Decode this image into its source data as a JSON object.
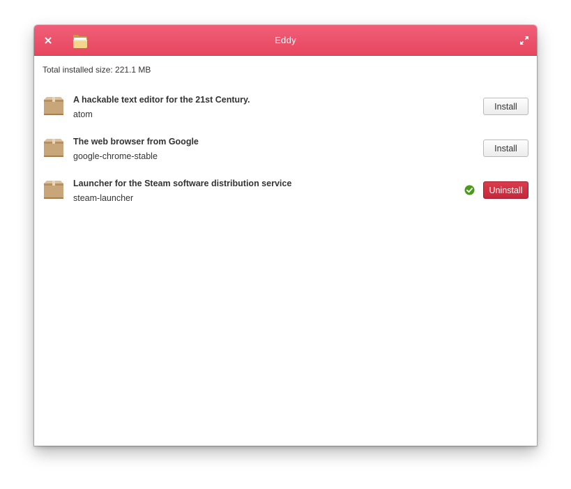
{
  "window": {
    "title": "Eddy",
    "accent_color": "#e8465f"
  },
  "toolbar": {
    "close_icon": "close-icon",
    "open_icon": "folder-icon",
    "maximize_icon": "maximize-icon"
  },
  "summary": {
    "text": "Total installed size: 221.1 MB"
  },
  "packages": [
    {
      "summary": "A hackable text editor for the 21st Century.",
      "name": "atom",
      "action_label": "Install",
      "installed": false
    },
    {
      "summary": "The web browser from Google",
      "name": "google-chrome-stable",
      "action_label": "Install",
      "installed": false
    },
    {
      "summary": "Launcher for the Steam software distribution service",
      "name": "steam-launcher",
      "action_label": "Uninstall",
      "installed": true
    }
  ]
}
